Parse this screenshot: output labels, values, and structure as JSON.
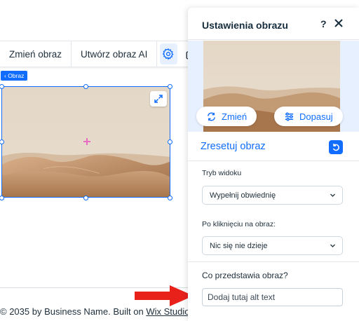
{
  "toolbar": {
    "change_image_label": "Zmień obraz",
    "create_ai_label": "Utwórz obraz AI",
    "settings_icon": "gear-icon",
    "duplicate_icon": "copy-icon"
  },
  "element_tag": "‹ Obraz",
  "footer": {
    "text": "© 2035 by Business Name. Built on ",
    "link": "Wix Studio"
  },
  "panel": {
    "title": "Ustawienia obrazu",
    "help": "?",
    "close_icon": "close-icon",
    "change_button": "Zmień",
    "adjust_button": "Dopasuj",
    "reset_label": "Zresetuj obraz",
    "display_mode": {
      "label": "Tryb widoku",
      "value": "Wypełnij obwiednię"
    },
    "on_click": {
      "label": "Po kliknięciu na obraz:",
      "value": "Nic się nie dzieje"
    },
    "alt_text": {
      "label": "Co przedstawia obraz?",
      "placeholder": "Dodaj tutaj alt text"
    }
  },
  "colors": {
    "accent": "#116dff",
    "arrow": "#e8221b",
    "preview_bg": "#e7f0ff"
  }
}
